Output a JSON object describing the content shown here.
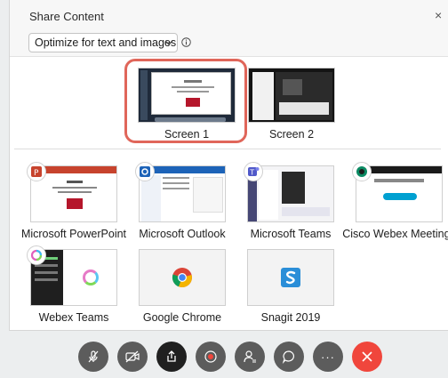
{
  "dialog": {
    "title": "Share Content",
    "close_glyph": "×",
    "optimize_select": {
      "selected": "Optimize for text and images"
    }
  },
  "screens": [
    {
      "label": "Screen 1",
      "selected": true
    },
    {
      "label": "Screen 2",
      "selected": false
    }
  ],
  "apps": [
    {
      "label": "Microsoft PowerPoint",
      "icon": "powerpoint-icon"
    },
    {
      "label": "Microsoft Outlook",
      "icon": "outlook-icon"
    },
    {
      "label": "Microsoft Teams",
      "icon": "teams-icon"
    },
    {
      "label": "Cisco Webex Meetings",
      "icon": "webex-meetings-icon"
    },
    {
      "label": "Webex Teams",
      "icon": "webex-teams-icon"
    },
    {
      "label": "Google Chrome",
      "icon": "chrome-icon"
    },
    {
      "label": "Snagit 2019",
      "icon": "snagit-icon"
    }
  ],
  "toolbar": {
    "more_glyph": "···",
    "buttons": [
      "mute-icon",
      "video-off-icon",
      "share-icon",
      "record-icon",
      "participants-icon",
      "chat-icon",
      "more-icon",
      "end-call-icon"
    ]
  },
  "colors": {
    "selection_ring": "#e0665a",
    "end_call": "#f0463c",
    "toolbar_button": "#5c5c5c"
  }
}
